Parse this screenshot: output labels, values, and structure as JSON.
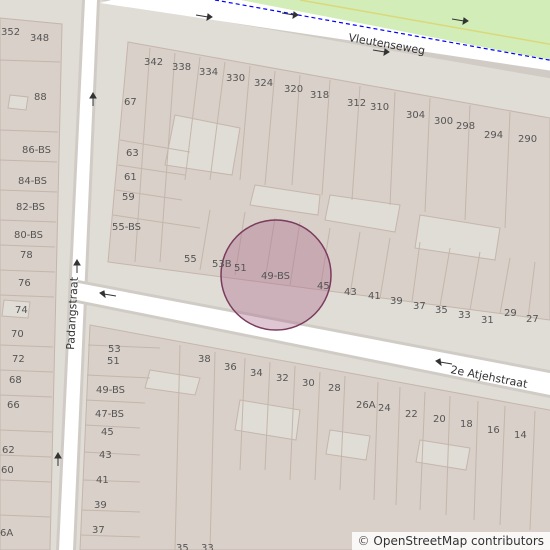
{
  "streets": {
    "vleutenseweg": "Vleutenseweg",
    "atjehstraat": "2e Atjehstraat",
    "padangstraat": "Padangstraat"
  },
  "house_numbers": {
    "top_left": [
      "352",
      "348",
      "88",
      "86-BS",
      "84-BS",
      "82-BS",
      "80-BS",
      "78",
      "76",
      "74",
      "72",
      "70",
      "68",
      "66",
      "62",
      "60",
      "6A"
    ],
    "vleutenseweg_side": [
      "342",
      "338",
      "334",
      "330",
      "324",
      "320",
      "318",
      "312",
      "310",
      "304",
      "300",
      "298",
      "294",
      "290"
    ],
    "block_left": [
      "67",
      "63",
      "61",
      "59",
      "55-BS",
      "55",
      "53B",
      "51",
      "49-BS",
      "45",
      "43",
      "41",
      "39",
      "37",
      "35",
      "33",
      "31",
      "29",
      "27"
    ],
    "block_south": [
      "53",
      "51",
      "49-BS",
      "47-BS",
      "45",
      "43",
      "41",
      "39",
      "37",
      "38",
      "36",
      "34",
      "32",
      "30",
      "28",
      "26A",
      "24",
      "22",
      "20",
      "18",
      "16",
      "14",
      "35",
      "33"
    ]
  },
  "attribution": {
    "symbol": "©",
    "text": "OpenStreetMap contributors"
  },
  "colors": {
    "background": "#e0dcd6",
    "building": "#d9d0c9",
    "building_stroke": "#c4b6ab",
    "road": "#ffffff",
    "road_casing": "#d0ccc5",
    "cycle_lane": "#cdebb0",
    "cycle_dash": "#0000ff",
    "highlight_fill": "#b07090",
    "highlight_stroke": "#7a3b5e"
  },
  "highlight_marker": "circle around 49-BS"
}
